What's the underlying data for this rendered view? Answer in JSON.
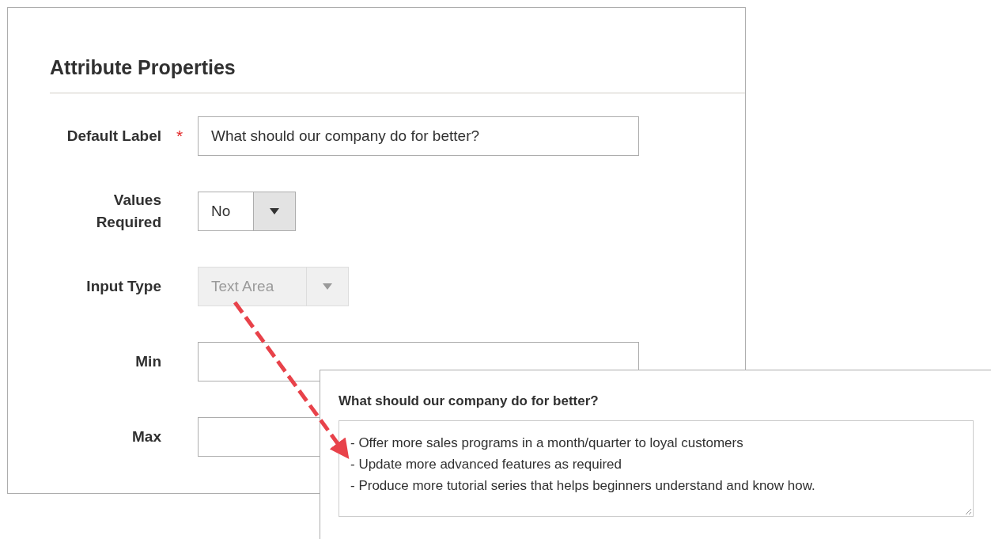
{
  "panel": {
    "title": "Attribute Properties",
    "required_mark": "*",
    "fields": [
      {
        "label": "Default Label",
        "kind": "text",
        "required": true,
        "value": "What should our company do for better?"
      },
      {
        "label": "Values Required",
        "kind": "select",
        "required": false,
        "disabled": false,
        "value": "No"
      },
      {
        "label": "Input Type",
        "kind": "select",
        "required": false,
        "disabled": true,
        "value": "Text Area"
      },
      {
        "label": "Min",
        "kind": "text",
        "required": false
      },
      {
        "label": "Max",
        "kind": "text",
        "required": false
      }
    ]
  },
  "preview": {
    "question": "What should our company do for better?",
    "answer": "- Offer more sales programs in a month/quarter to loyal customers\n- Update more advanced features as required\n- Produce more tutorial series that helps beginners understand and know how."
  }
}
